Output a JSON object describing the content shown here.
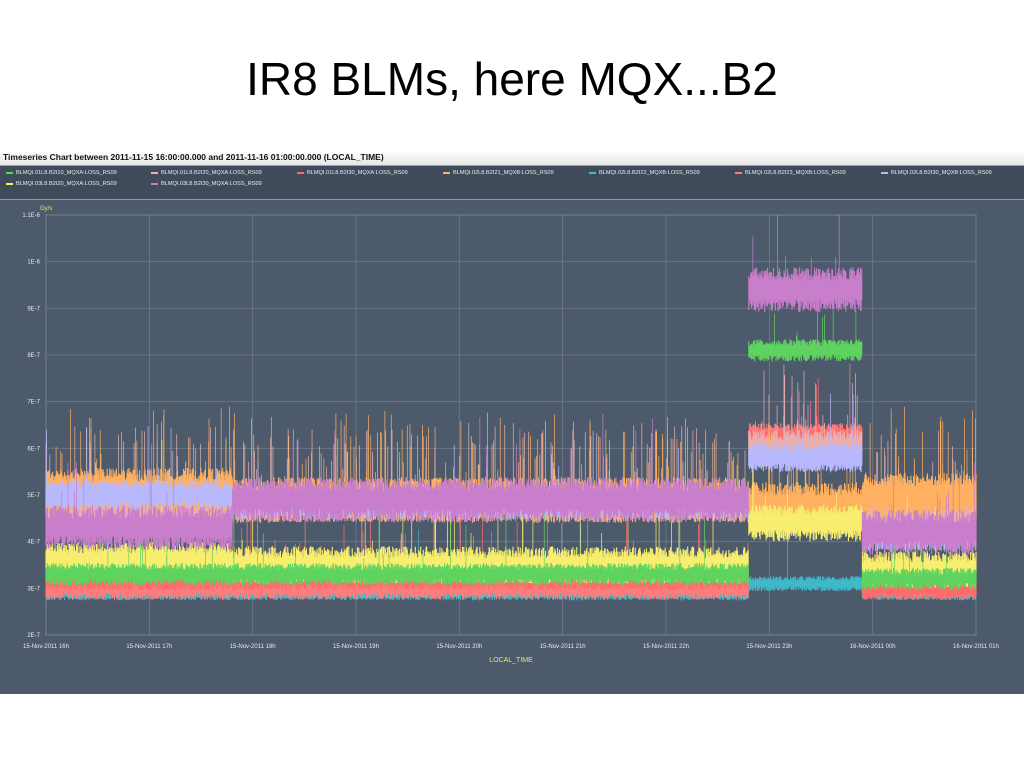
{
  "slide": {
    "title": "IR8 BLMs, here MQX...B2"
  },
  "window": {
    "title": "Timeseries Chart between 2011-11-15 16:00:00.000 and 2011-11-16 01:00:00.000 (LOCAL_TIME)"
  },
  "colors": {
    "background": "#4d5a6b",
    "grid": "#6f7b8a",
    "axis_title": "#e8e86a"
  },
  "chart_data": {
    "type": "line",
    "title": "",
    "xlabel": "LOCAL_TIME",
    "ylabel": "",
    "y_unit": "Gy/s",
    "x_range": [
      "15-Nov-2011 16h",
      "16-Nov-2011 01h"
    ],
    "ylim": [
      2e-07,
      1.1e-06
    ],
    "grid": true,
    "legend_position": "top",
    "x_ticks": [
      "15-Nov-2011 16h",
      "15-Nov-2011 17h",
      "15-Nov-2011 18h",
      "15-Nov-2011 19h",
      "15-Nov-2011 20h",
      "15-Nov-2011 21h",
      "15-Nov-2011 22h",
      "15-Nov-2011 23h",
      "16-Nov-2011 00h",
      "16-Nov-2011 01h"
    ],
    "y_ticks": [
      {
        "value": 1.1e-06,
        "label": "1.1E-6"
      },
      {
        "value": 1e-06,
        "label": "1E-6"
      },
      {
        "value": 9e-07,
        "label": "9E-7"
      },
      {
        "value": 8e-07,
        "label": "8E-7"
      },
      {
        "value": 7e-07,
        "label": "7E-7"
      },
      {
        "value": 6e-07,
        "label": "6E-7"
      },
      {
        "value": 5e-07,
        "label": "5E-7"
      },
      {
        "value": 4e-07,
        "label": "4E-7"
      },
      {
        "value": 3e-07,
        "label": "3E-7"
      },
      {
        "value": 2e-07,
        "label": "2E-7"
      }
    ],
    "series": [
      {
        "name": "BLMQI.01L8.B2I10_MQXA:LOSS_RS09",
        "color": "#5fd35f",
        "hours": [
          0,
          1.8,
          1.8,
          6.8,
          6.8,
          7.9,
          7.9,
          9
        ],
        "values": [
          3.3e-07,
          3.3e-07,
          3.3e-07,
          3.3e-07,
          8.1e-07,
          8.1e-07,
          3.2e-07,
          3.2e-07
        ],
        "spread": 1.5e-08
      },
      {
        "name": "BLMQI.01L8.B2I20_MQXA:LOSS_RS09",
        "color": "#e8b0b0",
        "hours": [
          0,
          1.8,
          1.8,
          6.8,
          6.8,
          7.9,
          7.9,
          9
        ],
        "values": [
          4.7e-07,
          4.7e-07,
          4.8e-07,
          4.8e-07,
          6e-07,
          6e-07,
          4.6e-07,
          4.6e-07
        ],
        "spread": 2.5e-08
      },
      {
        "name": "BLMQI.01L8.B2I30_MQXA:LOSS_RS09",
        "color": "#ff6a6a",
        "hours": [
          0,
          1.8,
          1.8,
          6.8,
          6.8,
          7.9,
          7.9,
          9
        ],
        "values": [
          3.2e-07,
          3.2e-07,
          3.2e-07,
          3.2e-07,
          6.2e-07,
          6.2e-07,
          3e-07,
          3e-07
        ],
        "spread": 1.5e-08
      },
      {
        "name": "BLMQI.02L8.B2I21_MQXB:LOSS_RS09",
        "color": "#ffb060",
        "hours": [
          0,
          1.8,
          1.8,
          6.8,
          6.8,
          7.9,
          7.9,
          9
        ],
        "values": [
          5.1e-07,
          5.1e-07,
          4.9e-07,
          4.9e-07,
          4.8e-07,
          4.8e-07,
          5e-07,
          5e-07
        ],
        "spread": 3e-08
      },
      {
        "name": "BLMQI.02L8.B2I22_MQXB:LOSS_RS09",
        "color": "#3fb8c8",
        "hours": [
          0,
          1.8,
          1.8,
          6.8,
          6.8,
          7.9,
          7.9,
          9
        ],
        "values": [
          2.9e-07,
          2.9e-07,
          2.9e-07,
          2.9e-07,
          3.1e-07,
          3.1e-07,
          2.9e-07,
          2.9e-07
        ],
        "spread": 1e-08
      },
      {
        "name": "BLMQI.02L8.B2I23_MQXB:LOSS_RS09",
        "color": "#ff7c7c",
        "hours": [
          0,
          1.8,
          1.8,
          6.8,
          6.8,
          7.9,
          7.9,
          9
        ],
        "values": [
          3e-07,
          3e-07,
          3e-07,
          3e-07,
          6.3e-07,
          6.3e-07,
          3e-07,
          3e-07
        ],
        "spread": 1.5e-08
      },
      {
        "name": "BLMQI.02L8.B2I30_MQXB:LOSS_RS09",
        "color": "#b8b8ff",
        "hours": [
          0,
          1.8,
          1.8,
          6.8,
          6.8,
          7.9,
          7.9,
          9
        ],
        "values": [
          5e-07,
          5e-07,
          4.8e-07,
          4.8e-07,
          5.8e-07,
          5.8e-07,
          4.1e-07,
          4.1e-07
        ],
        "spread": 2e-08
      },
      {
        "name": "BLMQI.03L8.B2I20_MQXA:LOSS_RS09",
        "color": "#f7ee6f",
        "hours": [
          0,
          1.8,
          1.8,
          6.8,
          6.8,
          7.9,
          7.9,
          9
        ],
        "values": [
          3.6e-07,
          3.6e-07,
          3.5e-07,
          3.5e-07,
          4.4e-07,
          4.4e-07,
          3.4e-07,
          3.4e-07
        ],
        "spread": 2.5e-08
      },
      {
        "name": "BLMQI.03L8.B2I30_MQXA:LOSS_RS09",
        "color": "#c87ecb",
        "hours": [
          0,
          1.8,
          1.8,
          6.8,
          6.8,
          7.9,
          7.9,
          9
        ],
        "values": [
          4.3e-07,
          4.3e-07,
          4.9e-07,
          4.9e-07,
          9.4e-07,
          9.4e-07,
          4.2e-07,
          4.2e-07
        ],
        "spread": 3e-08
      }
    ]
  }
}
